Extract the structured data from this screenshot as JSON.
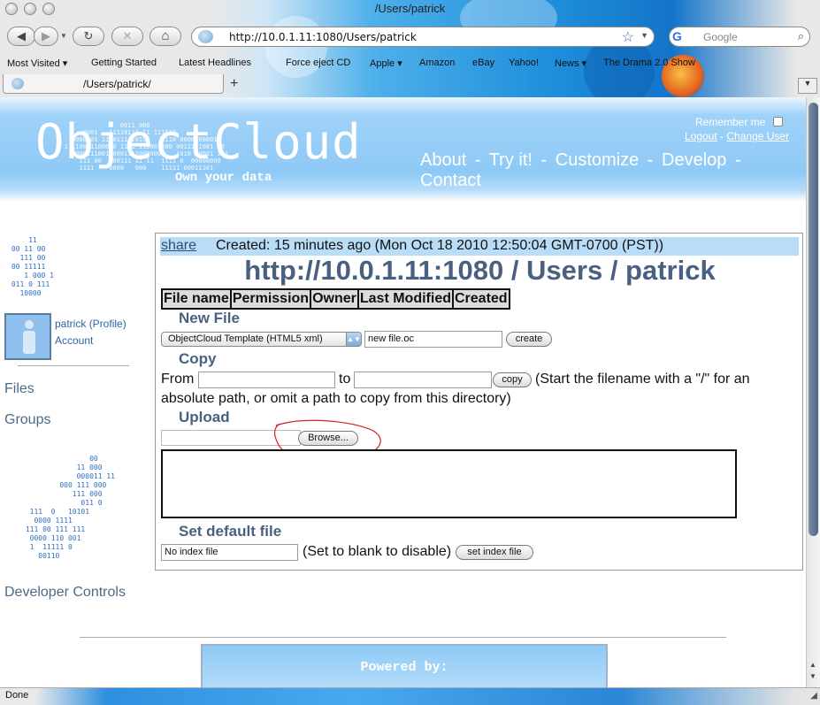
{
  "window": {
    "title": "/Users/patrick"
  },
  "toolbar": {
    "back": "◀",
    "forward": "▶",
    "reload": "↻",
    "stop": "✕",
    "home": "⌂",
    "url": "http://10.0.1.11:1080/Users/patrick",
    "search_placeholder": "Google"
  },
  "bookmarks": [
    "Most Visited ▾",
    "Getting Started",
    "Latest Headlines",
    "Force eject CD",
    "Apple ▾",
    "Amazon",
    "eBay",
    "Yahoo!",
    "News ▾",
    "The Drama 2.0 Show"
  ],
  "tab": {
    "title": "/Users/patrick/",
    "new_tab": "+"
  },
  "header": {
    "logo": "ObjectCloud",
    "tagline": "Own your data",
    "nav": [
      "About",
      "Try it!",
      "Customize",
      "Develop",
      "Contact"
    ],
    "remember_label": "Remember me",
    "logout": "Logout",
    "change_user": "Change User",
    "separator": "-"
  },
  "sidebar": {
    "user_name": "patrick",
    "profile_link": "(Profile)",
    "account": "Account",
    "files": "Files",
    "groups": "Groups",
    "developer_controls": "Developer Controls"
  },
  "content": {
    "share": "share",
    "created": "Created: 15 minutes ago (Mon Oct 18 2010 12:50:04 GMT-0700 (PST))",
    "path_title": "http://10.0.1.11:1080 / Users / patrick",
    "table_headers": [
      "File name",
      "Permission",
      "Owner",
      "Last Modified",
      "Created"
    ],
    "new_file": {
      "heading": "New File",
      "template_selected": "ObjectCloud Template (HTML5 xml)",
      "filename_value": "new file.oc",
      "button": "create"
    },
    "copy": {
      "heading": "Copy",
      "from_label": "From",
      "to_label": "to",
      "button": "copy",
      "hint_line1": "(Start the filename with a \"/\" for an",
      "hint_line2": "absolute path, or omit a path to copy from this directory)"
    },
    "upload": {
      "heading": "Upload",
      "browse": "Browse..."
    },
    "default_file": {
      "heading": "Set default file",
      "value": "No index file",
      "hint": "(Set to blank to disable)",
      "button": "set index file"
    }
  },
  "footer": {
    "powered_by": "Powered by:"
  },
  "status": {
    "text": "Done"
  },
  "colors": {
    "header_blue": "#8ec9f6",
    "heading_slate": "#4a6080",
    "annotation_red": "#d62020"
  }
}
